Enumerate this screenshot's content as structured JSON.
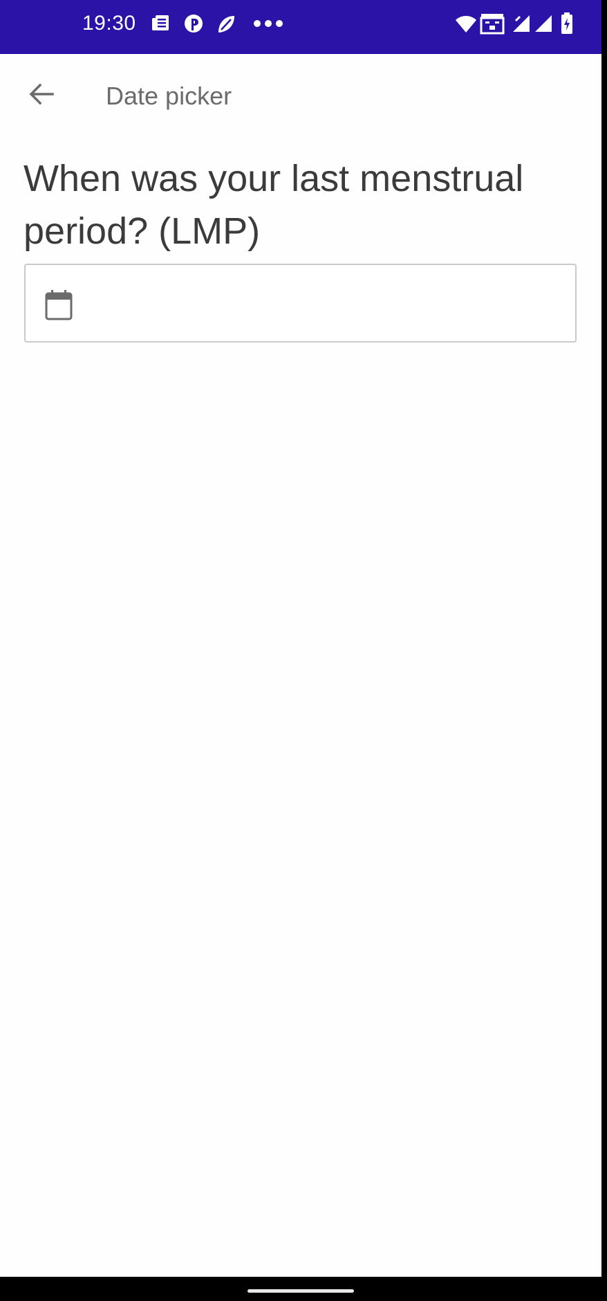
{
  "status_bar": {
    "time": "19:30",
    "left_icons": [
      "news-icon",
      "pinterest-icon",
      "leaf-icon",
      "more-dots-icon"
    ],
    "right_icons": [
      "wifi-icon",
      "data-saver-icon",
      "signal-icon",
      "signal-icon",
      "battery-icon"
    ],
    "background": "#2c13a8"
  },
  "app_bar": {
    "title": "Date picker",
    "back_icon": "arrow-back-icon"
  },
  "form": {
    "question": "When was your last menstrual period? (LMP)",
    "date_field": {
      "value": "",
      "icon": "calendar-icon"
    }
  },
  "colors": {
    "status_bar": "#2c13a8",
    "background": "#fefefe",
    "title_text": "#6b6b6b",
    "question_text": "#3b3b3b",
    "field_border": "#c9c9c9"
  }
}
